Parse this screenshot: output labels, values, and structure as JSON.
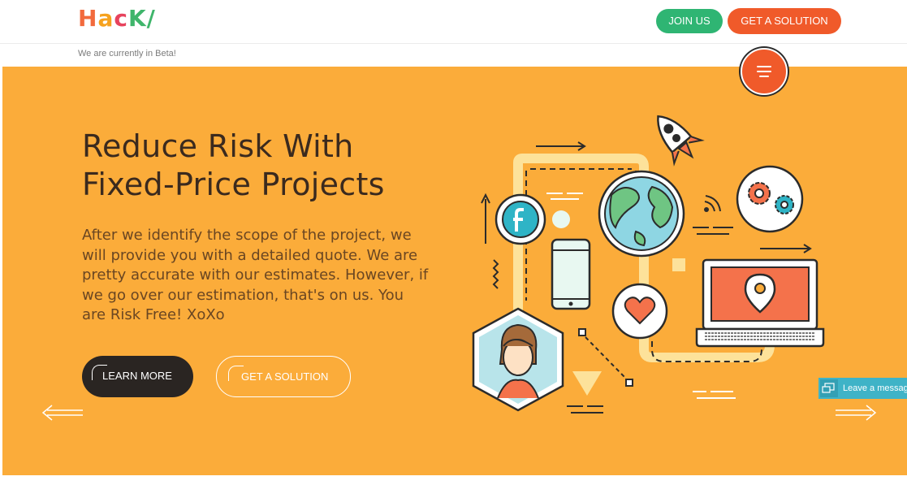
{
  "header": {
    "logo": {
      "h": "H",
      "a": "a",
      "c": "c",
      "k": "K",
      "slash": "/"
    },
    "join_label": "JOIN US",
    "solution_label": "GET A SOLUTION"
  },
  "beta_text": "We are currently in Beta!",
  "hero": {
    "title_line1": "Reduce Risk With",
    "title_line2": "Fixed-Price Projects",
    "description": "After we identify the scope of the project, we will provide you with a detailed quote. We are pretty accurate with our estimates. However, if we go over our estimation, that's on us. You are Risk Free! XoXo",
    "learn_more": "LEARN MORE",
    "get_solution": "GET A SOLUTION"
  },
  "chat": {
    "label": "Leave a message"
  },
  "colors": {
    "hero_bg": "#fbac3a",
    "accent_orange": "#f05a2a",
    "accent_green": "#2fb573",
    "dark": "#2a2522"
  },
  "icons": [
    "menu-icon",
    "arrow-left-icon",
    "arrow-right-icon",
    "chat-icon",
    "facebook-icon",
    "globe-icon",
    "rocket-icon",
    "gears-icon",
    "laptop-icon",
    "phone-icon",
    "heart-icon",
    "location-pin-icon",
    "avatar-icon"
  ]
}
